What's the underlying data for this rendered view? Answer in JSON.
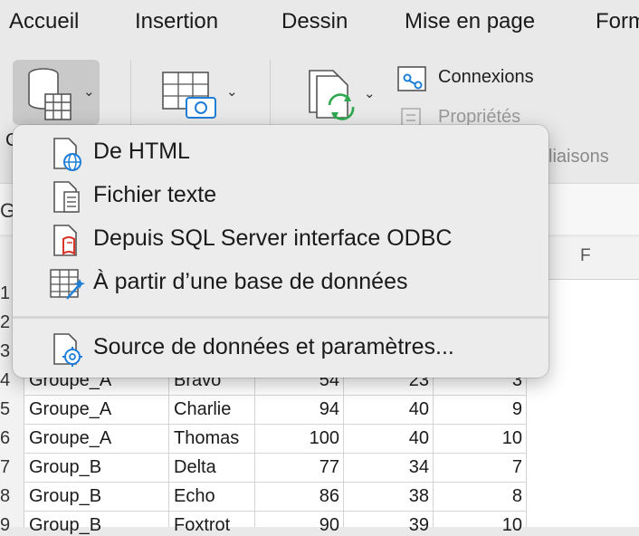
{
  "ribbon_tabs": [
    "Accueil",
    "Insertion",
    "Dessin",
    "Mise en page",
    "Form"
  ],
  "ribbon": {
    "connexions_label": "Connexions",
    "proprietes_label": "Propriétés",
    "group_label_partial": "liaisons",
    "get_data_label_partial": "C"
  },
  "namebox_partial": "G",
  "column_headers": {
    "f": "F"
  },
  "row_numbers": [
    "1",
    "2",
    "3",
    "4",
    "5",
    "6",
    "7",
    "8",
    "9"
  ],
  "rows": [
    {
      "a": "Groupe_A",
      "b": "Bravo",
      "c": "54",
      "d": "23",
      "e": "3"
    },
    {
      "a": "Groupe_A",
      "b": "Charlie",
      "c": "94",
      "d": "40",
      "e": "9"
    },
    {
      "a": "Groupe_A",
      "b": "Thomas",
      "c": "100",
      "d": "40",
      "e": "10"
    },
    {
      "a": "Group_B",
      "b": "Delta",
      "c": "77",
      "d": "34",
      "e": "7"
    },
    {
      "a": "Group_B",
      "b": "Echo",
      "c": "86",
      "d": "38",
      "e": "8"
    },
    {
      "a": "Group_B",
      "b": "Foxtrot",
      "c": "90",
      "d": "39",
      "e": "10"
    }
  ],
  "menu": {
    "items": [
      {
        "label": "De HTML",
        "icon": "html-document-icon"
      },
      {
        "label": "Fichier texte",
        "icon": "text-file-icon"
      },
      {
        "label": "Depuis SQL Server interface ODBC",
        "icon": "sql-server-icon"
      },
      {
        "label": "À partir d’une base de données",
        "icon": "database-wizard-icon"
      }
    ],
    "footer_item": {
      "label": "Source de données et paramètres...",
      "icon": "data-source-settings-icon"
    }
  },
  "colors": {
    "accent_blue": "#1f7ed8",
    "sql_red": "#d9352b",
    "refresh_green": "#2fa84f"
  }
}
